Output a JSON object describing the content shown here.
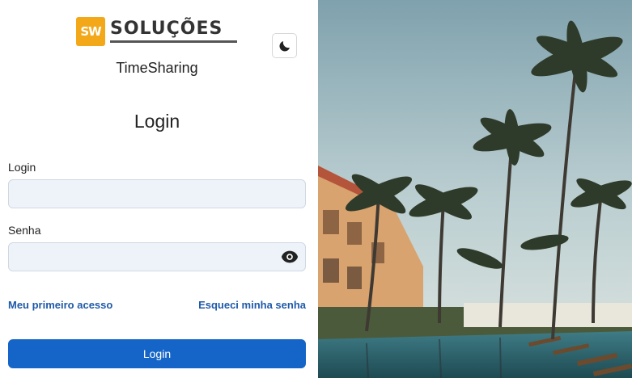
{
  "brand": {
    "logo_mark": "SW",
    "logo_name": "SOLUÇÕES",
    "app_name": "TimeSharing"
  },
  "form": {
    "title": "Login",
    "login_label": "Login",
    "login_value": "",
    "password_label": "Senha",
    "password_value": "",
    "first_access_link": "Meu primeiro acesso",
    "forgot_password_link": "Esqueci minha senha",
    "submit_label": "Login"
  },
  "icons": {
    "theme_toggle": "moon-icon",
    "password_visibility": "eye-icon"
  },
  "colors": {
    "primary": "#1565c8",
    "link": "#1f5aa8",
    "logo_accent": "#f3a81a",
    "input_bg": "#eef3fa"
  }
}
